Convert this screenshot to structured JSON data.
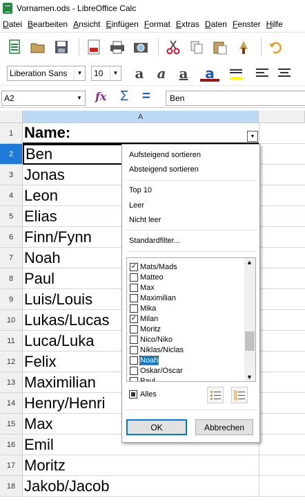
{
  "window": {
    "title": "Vornamen.ods - LibreOffice Calc"
  },
  "menu": [
    "Datei",
    "Bearbeiten",
    "Ansicht",
    "Einfügen",
    "Format",
    "Extras",
    "Daten",
    "Fenster",
    "Hilfe"
  ],
  "font": {
    "name": "Liberation Sans",
    "size": "10"
  },
  "namebox": {
    "value": "A2"
  },
  "formula": {
    "value": "Ben"
  },
  "column_header": "A",
  "rows": [
    {
      "num": "1",
      "value": "Name:"
    },
    {
      "num": "2",
      "value": "Ben"
    },
    {
      "num": "3",
      "value": "Jonas"
    },
    {
      "num": "4",
      "value": "Leon"
    },
    {
      "num": "5",
      "value": "Elias"
    },
    {
      "num": "6",
      "value": "Finn/Fynn"
    },
    {
      "num": "7",
      "value": "Noah"
    },
    {
      "num": "8",
      "value": "Paul"
    },
    {
      "num": "9",
      "value": "Luis/Louis"
    },
    {
      "num": "10",
      "value": "Lukas/Lucas"
    },
    {
      "num": "11",
      "value": "Luca/Luka"
    },
    {
      "num": "12",
      "value": "Felix"
    },
    {
      "num": "13",
      "value": "Maximilian"
    },
    {
      "num": "14",
      "value": "Henry/Henri"
    },
    {
      "num": "15",
      "value": "Max"
    },
    {
      "num": "16",
      "value": "Emil"
    },
    {
      "num": "17",
      "value": "Moritz"
    },
    {
      "num": "18",
      "value": "Jakob/Jacob"
    }
  ],
  "autofilter": {
    "sort_asc": "Aufsteigend sortieren",
    "sort_desc": "Absteigend sortieren",
    "top10": "Top 10",
    "empty": "Leer",
    "not_empty": "Nicht leer",
    "standard_filter": "Standardfilter...",
    "items": [
      {
        "label": "Mats/Mads",
        "checked": true
      },
      {
        "label": "Matteo",
        "checked": false
      },
      {
        "label": "Max",
        "checked": false
      },
      {
        "label": "Maximilian",
        "checked": false
      },
      {
        "label": "Mika",
        "checked": false
      },
      {
        "label": "Milan",
        "checked": true
      },
      {
        "label": "Moritz",
        "checked": false
      },
      {
        "label": "Nico/Niko",
        "checked": false
      },
      {
        "label": "Niklas/Niclas",
        "checked": false
      },
      {
        "label": "Noah",
        "checked": false
      },
      {
        "label": "Oskar/Oscar",
        "checked": false
      },
      {
        "label": "Paul",
        "checked": false
      }
    ],
    "all_label": "Alles",
    "ok": "OK",
    "cancel": "Abbrechen"
  },
  "colors": {
    "accent": "#1f8a3a",
    "selection": "#0078d7",
    "colhdr_selected": "#bcd9f5"
  }
}
